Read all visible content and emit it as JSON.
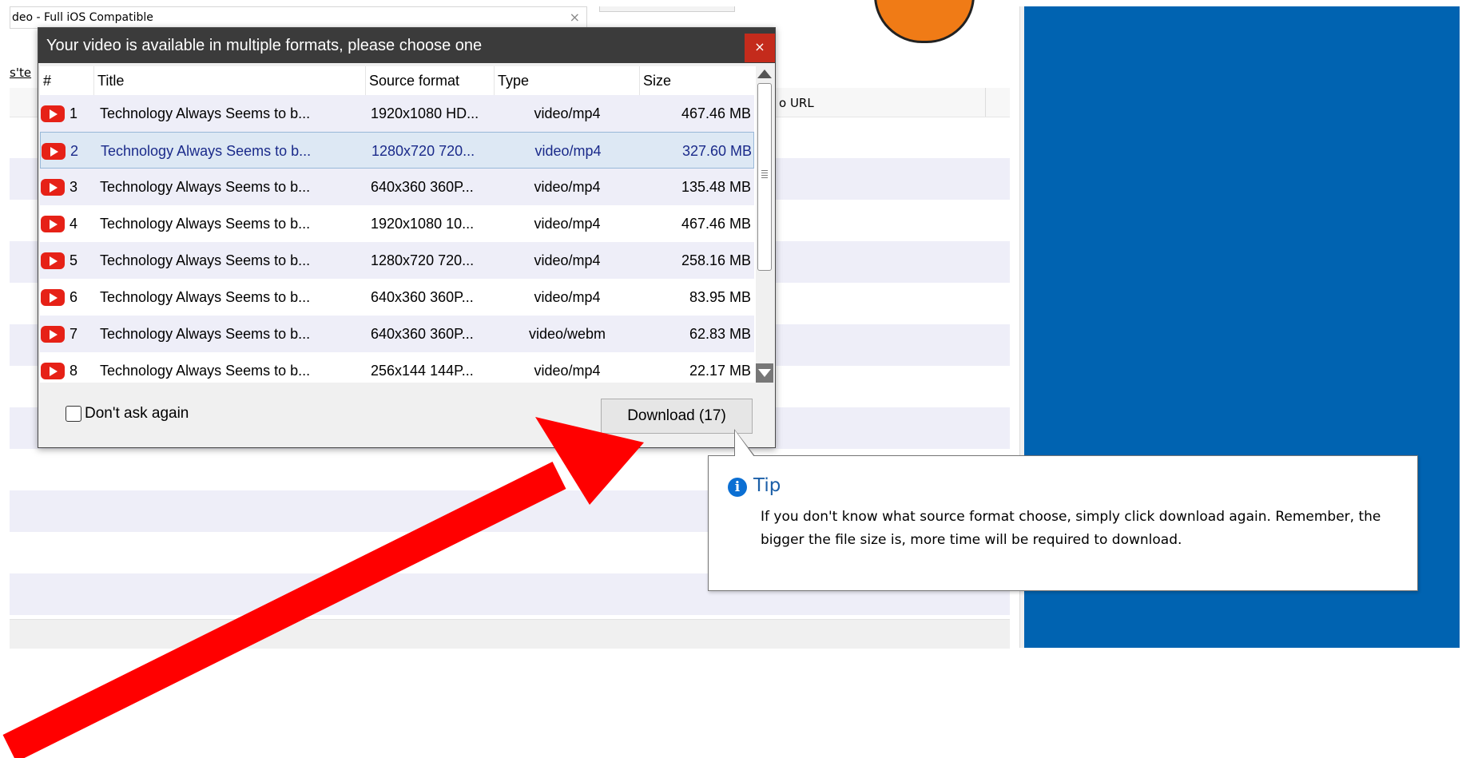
{
  "background": {
    "top_field_text": "deo - Full iOS Compatible",
    "link_text": "s'te",
    "column_video_url": "o URL"
  },
  "dialog": {
    "title": "Your video is available in multiple formats, please choose one",
    "close_glyph": "×",
    "columns": {
      "num": "#",
      "title": "Title",
      "source_format": "Source format",
      "type": "Type",
      "size": "Size"
    },
    "rows": [
      {
        "num": "1",
        "title": "Technology Always Seems to b...",
        "source_format": "1920x1080 HD...",
        "type": "video/mp4",
        "size": "467.46 MB"
      },
      {
        "num": "2",
        "title": "Technology Always Seems to b...",
        "source_format": "1280x720 720...",
        "type": "video/mp4",
        "size": "327.60 MB"
      },
      {
        "num": "3",
        "title": "Technology Always Seems to b...",
        "source_format": "640x360 360P...",
        "type": "video/mp4",
        "size": "135.48 MB"
      },
      {
        "num": "4",
        "title": "Technology Always Seems to b...",
        "source_format": "1920x1080 10...",
        "type": "video/mp4",
        "size": "467.46 MB"
      },
      {
        "num": "5",
        "title": "Technology Always Seems to b...",
        "source_format": "1280x720 720...",
        "type": "video/mp4",
        "size": "258.16 MB"
      },
      {
        "num": "6",
        "title": "Technology Always Seems to b...",
        "source_format": "640x360 360P...",
        "type": "video/mp4",
        "size": "83.95 MB"
      },
      {
        "num": "7",
        "title": "Technology Always Seems to b...",
        "source_format": "640x360 360P...",
        "type": "video/webm",
        "size": "62.83 MB"
      },
      {
        "num": "8",
        "title": "Technology Always Seems to b...",
        "source_format": "256x144 144P...",
        "type": "video/mp4",
        "size": "22.17 MB"
      }
    ],
    "selected_row": 2,
    "dont_ask_label": "Don't ask again",
    "dont_ask_checked": false,
    "download_label": "Download (17)"
  },
  "tip": {
    "title": "Tip",
    "icon": "info-icon",
    "text": "If you don't know what source format choose, simply click download again. Remember, the bigger the file size is, more time will be required to download."
  },
  "colors": {
    "titlebar": "#3b3b3b",
    "close": "#c42b1c",
    "selection": "#dde8f4",
    "alt_row": "#eeeef8",
    "blue_panel": "#0063b1",
    "arrow": "#ff0000",
    "youtube": "#e62117"
  }
}
